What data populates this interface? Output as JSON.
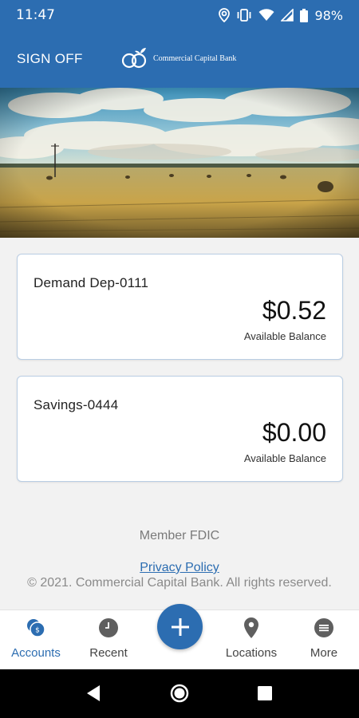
{
  "status_bar": {
    "time": "11:47",
    "battery": "98%",
    "icons": [
      "location-icon",
      "vibrate-icon",
      "wifi-icon",
      "signal-icon",
      "battery-icon"
    ]
  },
  "header": {
    "sign_off_label": "SIGN OFF",
    "bank_name": "Commercial Capital Bank",
    "color": "#2c6db1"
  },
  "accounts": [
    {
      "name": "Demand Dep-0111",
      "amount": "$0.52",
      "caption": "Available Balance"
    },
    {
      "name": "Savings-0444",
      "amount": "$0.00",
      "caption": "Available Balance"
    }
  ],
  "footer": {
    "member_fdic": "Member FDIC",
    "privacy_policy": "Privacy Policy",
    "copyright": "© 2021. Commercial Capital Bank. All rights reserved."
  },
  "bottom_nav": {
    "items": [
      {
        "label": "Accounts",
        "icon": "accounts-icon",
        "active": true
      },
      {
        "label": "Recent",
        "icon": "clock-icon",
        "active": false
      },
      {
        "label": "Locations",
        "icon": "location-pin-icon",
        "active": false
      },
      {
        "label": "More",
        "icon": "more-icon",
        "active": false
      }
    ],
    "fab_icon": "plus-icon"
  },
  "system_nav": {
    "icons": [
      "back-icon",
      "home-icon",
      "recents-icon"
    ]
  }
}
